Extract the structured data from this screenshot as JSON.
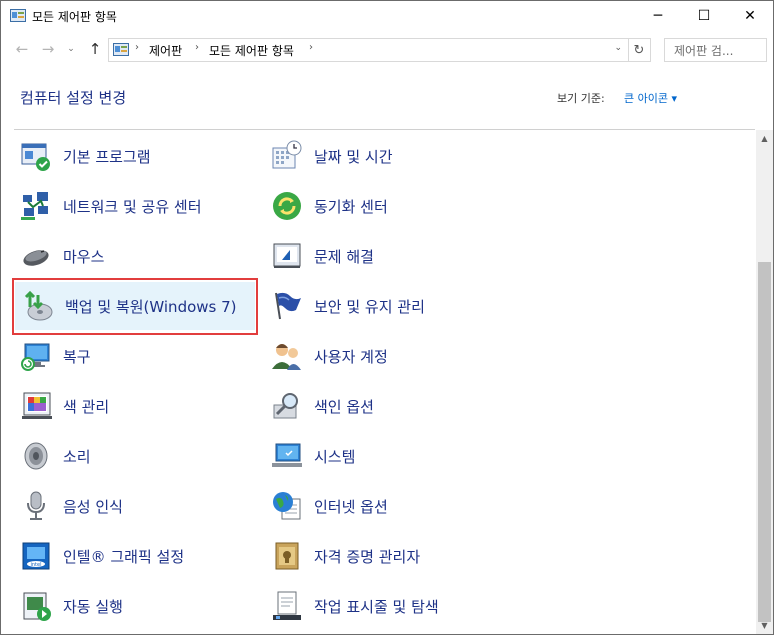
{
  "window": {
    "title": "모든 제어판 항목",
    "minimize_glyph": "─",
    "maximize_glyph": "☐",
    "close_glyph": "✕"
  },
  "nav": {
    "back_glyph": "←",
    "forward_glyph": "→",
    "recent_glyph": "⌄",
    "up_glyph": "↑",
    "breadcrumb": [
      "제어판",
      "모든 제어판 항목"
    ],
    "separator_glyph": "›",
    "dropdown_glyph": "⌄",
    "refresh_glyph": "↻",
    "search_placeholder": "제어판 검..."
  },
  "header": {
    "title": "컴퓨터 설정 변경",
    "view_by_label": "보기 기준:",
    "view_by_value": "큰 아이콘 ▾"
  },
  "items": [
    {
      "label": "기본 프로그램",
      "icon": "default-programs-icon"
    },
    {
      "label": "날짜 및 시간",
      "icon": "date-time-icon"
    },
    {
      "label": "네트워크 및 공유 센터",
      "icon": "network-sharing-icon"
    },
    {
      "label": "동기화 센터",
      "icon": "sync-center-icon"
    },
    {
      "label": "마우스",
      "icon": "mouse-icon"
    },
    {
      "label": "문제 해결",
      "icon": "troubleshooting-icon"
    },
    {
      "label": "백업 및 복원(Windows 7)",
      "icon": "backup-restore-icon",
      "selected": true
    },
    {
      "label": "보안 및 유지 관리",
      "icon": "security-maintenance-flag-icon"
    },
    {
      "label": "복구",
      "icon": "recovery-icon"
    },
    {
      "label": "사용자 계정",
      "icon": "user-accounts-icon"
    },
    {
      "label": "색 관리",
      "icon": "color-management-icon"
    },
    {
      "label": "색인 옵션",
      "icon": "indexing-options-icon"
    },
    {
      "label": "소리",
      "icon": "sound-speaker-icon"
    },
    {
      "label": "시스템",
      "icon": "system-icon"
    },
    {
      "label": "음성 인식",
      "icon": "speech-recognition-microphone-icon"
    },
    {
      "label": "인터넷 옵션",
      "icon": "internet-options-icon"
    },
    {
      "label": "인텔® 그래픽 설정",
      "icon": "intel-graphics-icon"
    },
    {
      "label": "자격 증명 관리자",
      "icon": "credential-manager-icon"
    },
    {
      "label": "자동 실행",
      "icon": "autoplay-icon"
    },
    {
      "label": "작업 표시줄 및 탐색",
      "icon": "taskbar-navigation-icon"
    }
  ],
  "colors": {
    "link_text": "#1e3287",
    "view_link": "#0066cc",
    "highlight_border": "#e23d3d",
    "selection_bg": "#e5f3fb"
  },
  "scrollbar": {
    "up_glyph": "▲",
    "down_glyph": "▼"
  }
}
